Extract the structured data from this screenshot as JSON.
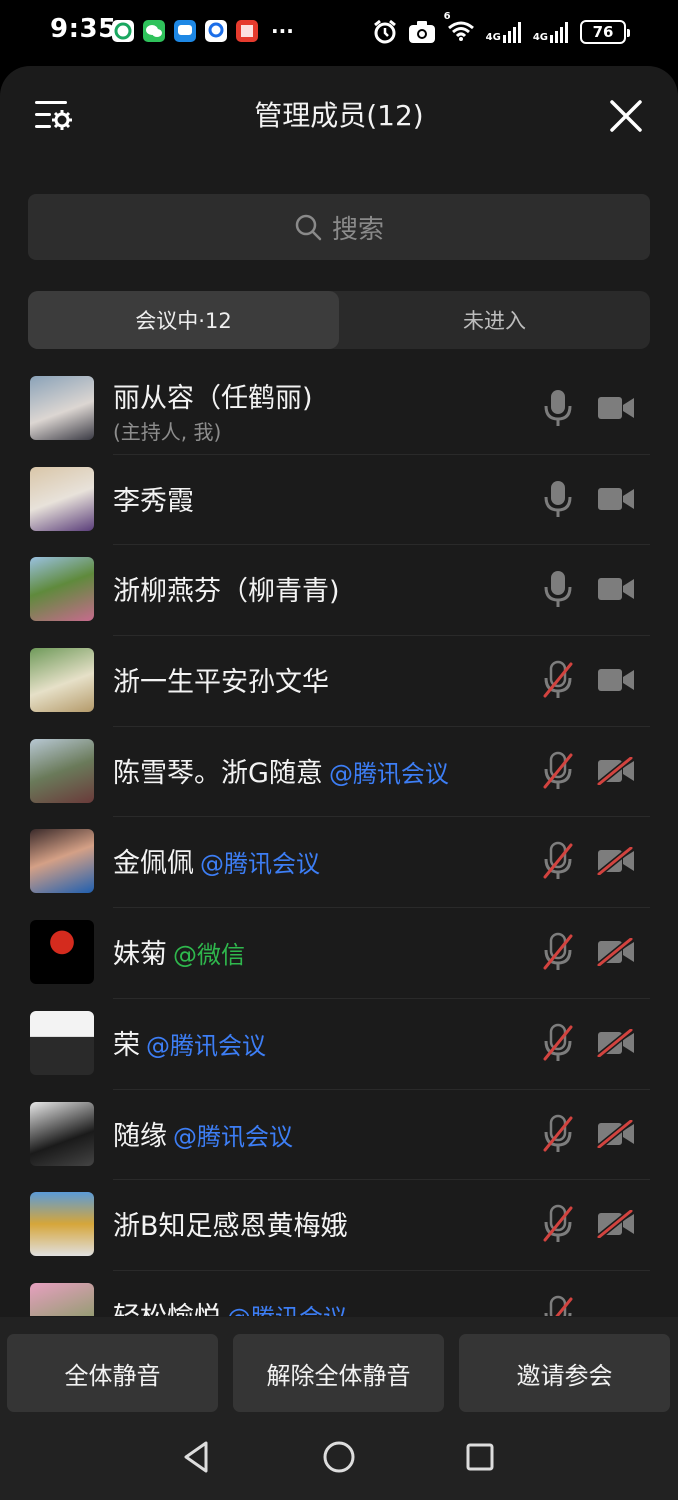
{
  "status_bar": {
    "time": "9:35",
    "more": "···",
    "network_1": "4G",
    "network_2": "4G",
    "battery": "76",
    "wifi_label": "6"
  },
  "header": {
    "title": "管理成员(12)"
  },
  "search": {
    "placeholder": "搜索"
  },
  "tabs": [
    {
      "label": "会议中·12",
      "active": true
    },
    {
      "label": "未进入",
      "active": false
    }
  ],
  "colors": {
    "tencent": "#3d7ef5",
    "wechat": "#2fb84d",
    "muted_red": "#d2433f",
    "icon_grey": "#7d7d7d"
  },
  "members": [
    {
      "name": "丽从容（任鹤丽)",
      "sub": "(主持人, 我)",
      "source": "",
      "mic": "on",
      "cam": "on"
    },
    {
      "name": "李秀霞",
      "sub": "",
      "source": "",
      "mic": "on",
      "cam": "on"
    },
    {
      "name": "浙柳燕芬（柳青青)",
      "sub": "",
      "source": "",
      "mic": "on",
      "cam": "on"
    },
    {
      "name": "浙一生平安孙文华",
      "sub": "",
      "source": "",
      "mic": "off",
      "cam": "on"
    },
    {
      "name": "陈雪琴。浙G随意",
      "sub": "",
      "source": "@腾讯会议",
      "mic": "off",
      "cam": "off"
    },
    {
      "name": "金佩佩",
      "sub": "",
      "source": "@腾讯会议",
      "mic": "off",
      "cam": "off"
    },
    {
      "name": "妹菊",
      "sub": "",
      "source": "@微信",
      "mic": "off",
      "cam": "off"
    },
    {
      "name": "荣",
      "sub": "",
      "source": "@腾讯会议",
      "mic": "off",
      "cam": "off"
    },
    {
      "name": "随缘",
      "sub": "",
      "source": "@腾讯会议",
      "mic": "off",
      "cam": "off"
    },
    {
      "name": "浙B知足感恩黄梅娥",
      "sub": "",
      "source": "",
      "mic": "off",
      "cam": "off"
    },
    {
      "name": "轻松愉悦",
      "sub": "",
      "source": "@腾讯会议",
      "mic": "off",
      "cam": "none"
    }
  ],
  "actions": {
    "mute_all": "全体静音",
    "unmute_all": "解除全体静音",
    "invite": "邀请参会"
  }
}
